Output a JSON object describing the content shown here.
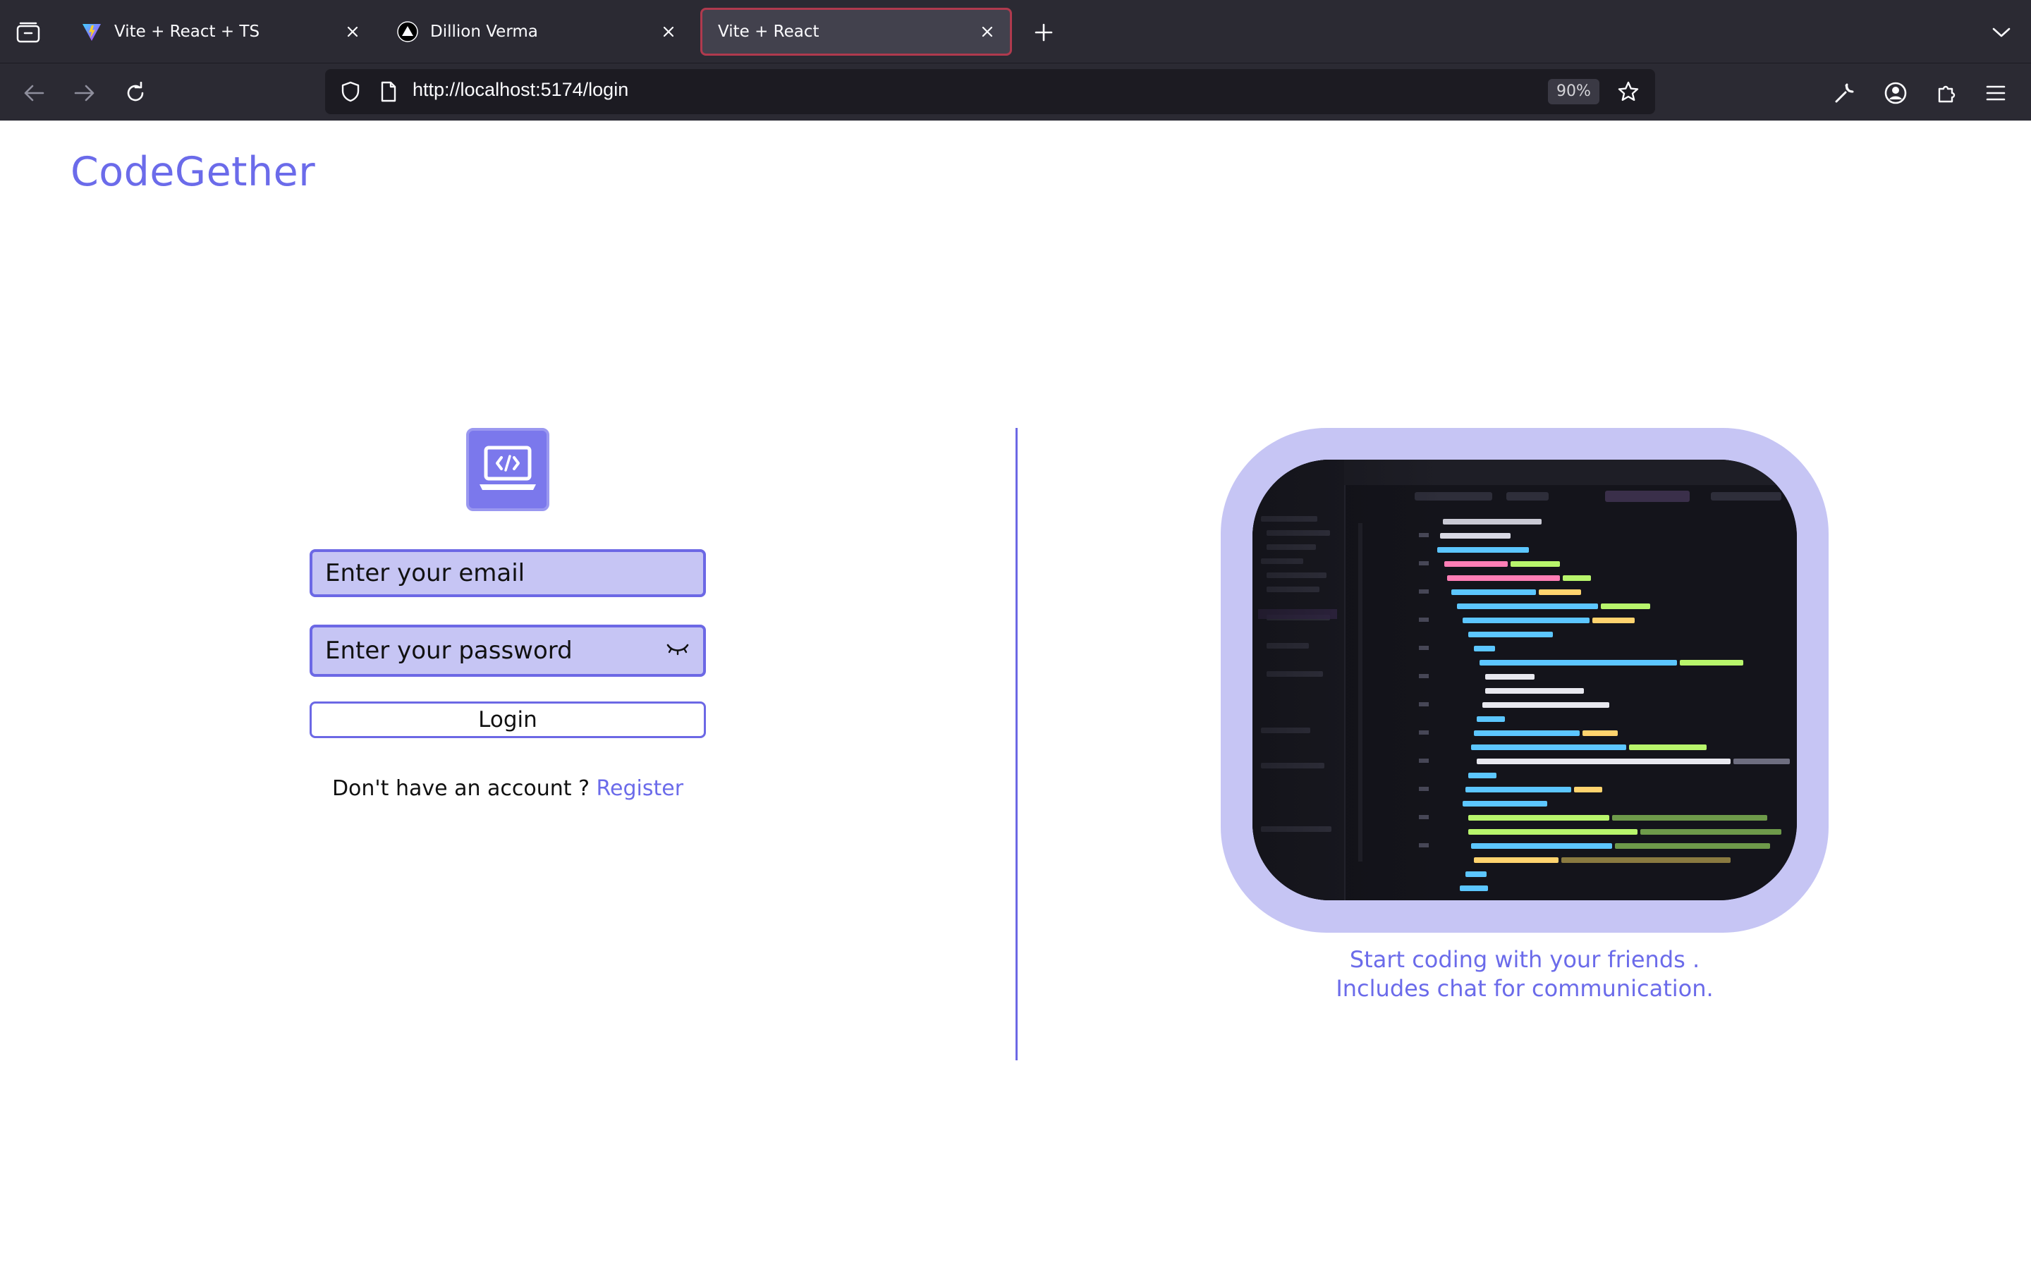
{
  "browser": {
    "tabs": [
      {
        "title": "Vite + React + TS",
        "icon": "vite-icon",
        "active": false
      },
      {
        "title": "Dillion Verma",
        "icon": "triangle-logo-icon",
        "active": false
      },
      {
        "title": "Vite + React",
        "icon": "",
        "active": true
      }
    ],
    "url": "http://localhost:5174/login",
    "zoom": "90%"
  },
  "app": {
    "brand": "CodeGether",
    "form": {
      "email_placeholder": "Enter your email",
      "password_placeholder": "Enter your password",
      "login_label": "Login",
      "no_account_text": "Don't have an account ? ",
      "register_label": "Register"
    },
    "hero": {
      "image": "code-editor-screenshot",
      "tagline_line1": "Start coding with your friends .",
      "tagline_line2": "Includes chat for communication."
    }
  },
  "colors": {
    "accent": "#6b6bea",
    "accent_light": "#c6c5f4",
    "chrome_bg": "#2b2a33"
  }
}
